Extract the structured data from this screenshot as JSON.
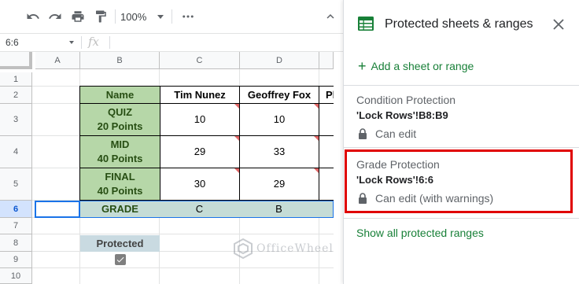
{
  "toolbar": {
    "zoom": "100%",
    "icons": [
      "undo-icon",
      "redo-icon",
      "print-icon",
      "paint-format-icon",
      "more-icon",
      "collapse-icon"
    ]
  },
  "formula_bar": {
    "name_box": "6:6",
    "fx_label": "fx"
  },
  "grid": {
    "columns": [
      "A",
      "B",
      "C",
      "D"
    ],
    "rows": [
      "1",
      "2",
      "3",
      "4",
      "5",
      "6",
      "7",
      "8",
      "9",
      "10"
    ],
    "table": {
      "header": [
        "Name",
        "Tim Nunez",
        "Geoffrey Fox",
        "Pl"
      ],
      "rows": [
        {
          "label_line1": "QUIZ",
          "label_line2": "20 Points",
          "values": [
            "10",
            "10"
          ]
        },
        {
          "label_line1": "MID",
          "label_line2": "40 Points",
          "values": [
            "29",
            "33"
          ]
        },
        {
          "label_line1": "FINAL",
          "label_line2": "40 Points",
          "values": [
            "30",
            "29"
          ]
        }
      ],
      "grade_row": {
        "label": "GRADE",
        "values": [
          "C",
          "B"
        ]
      }
    },
    "protected_label": "Protected",
    "protected_checked": true
  },
  "watermark": "OfficeWheel",
  "panel": {
    "title": "Protected sheets & ranges",
    "add_label": "Add a sheet or range",
    "items": [
      {
        "name": "Condition Protection",
        "range": "'Lock Rows'!B8:B9",
        "permission": "Can edit"
      },
      {
        "name": "Grade Protection",
        "range": "'Lock Rows'!6:6",
        "permission": "Can edit (with warnings)"
      }
    ],
    "show_all": "Show all protected ranges"
  },
  "colors": {
    "accent_green": "#188038",
    "table_green": "#b6d7a8",
    "grade_fill": "#c5dcd6",
    "protected_fill": "#c9dae1",
    "selection_blue": "#1a73e8",
    "highlight_red": "#e00000"
  }
}
